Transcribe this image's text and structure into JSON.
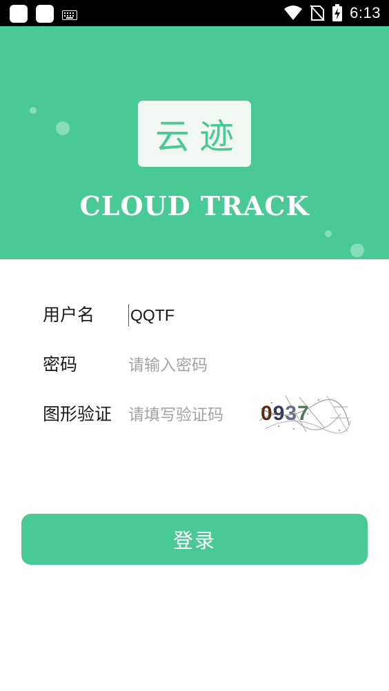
{
  "status_bar": {
    "time": "6:13",
    "icons": [
      "app-notification-icon",
      "app-notification-icon",
      "keyboard-icon",
      "wifi-icon",
      "no-sim-icon",
      "battery-charging-icon"
    ]
  },
  "header": {
    "logo_text": "云迹",
    "brand_name": "CLOUD TRACK",
    "background_color": "#48c995"
  },
  "form": {
    "username_label": "用户名",
    "username_value": "QQTF",
    "password_label": "密码",
    "password_placeholder": "请输入密码",
    "captcha_label": "图形验证",
    "captcha_placeholder": "请填写验证码",
    "captcha_text": "0937"
  },
  "login_button": {
    "label": "登录",
    "color": "#48c995"
  }
}
